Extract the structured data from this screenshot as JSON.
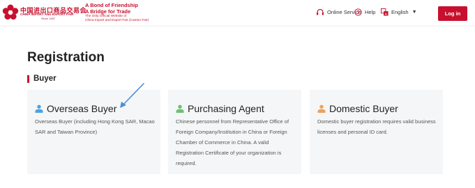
{
  "header": {
    "logo": {
      "cn_text": "中国进出口商品交易会",
      "en_text": "CHINA IMPORT AND EXPORT FAIR",
      "since": "Since 1957"
    },
    "slogan": {
      "line1": "A Bond of Friendship",
      "line2": "A Bridge for Trade",
      "line3": "The Only Official Website of",
      "line4": "China Import and Export Fair (Canton Fair)"
    },
    "online_service": "Online Service",
    "help": "Help",
    "language": "English",
    "language_caret": "▼",
    "login": "Log in"
  },
  "colors": {
    "brand_red": "#c8102e",
    "overseas_icon": "#4aa3e6",
    "purchasing_icon": "#6cc070",
    "domestic_icon": "#e8a35c",
    "annotation_arrow": "#4a8fd8"
  },
  "page": {
    "title": "Registration",
    "section": "Buyer"
  },
  "cards": [
    {
      "title": "Overseas Buyer",
      "icon": "person-icon",
      "description": "Overseas Buyer (including Hong Kong SAR, Macao SAR and Taiwan Province)"
    },
    {
      "title": "Purchasing Agent",
      "icon": "person-icon",
      "description": "Chinese personnel from Representative Office of Foreign Company/Institution in China or Foreign Chamber of Commerce in China. A valid Registration Certificate of your organization is required."
    },
    {
      "title": "Domestic Buyer",
      "icon": "person-icon",
      "description": "Domestic buyer registration requires valid business licenses and personal ID card."
    }
  ]
}
